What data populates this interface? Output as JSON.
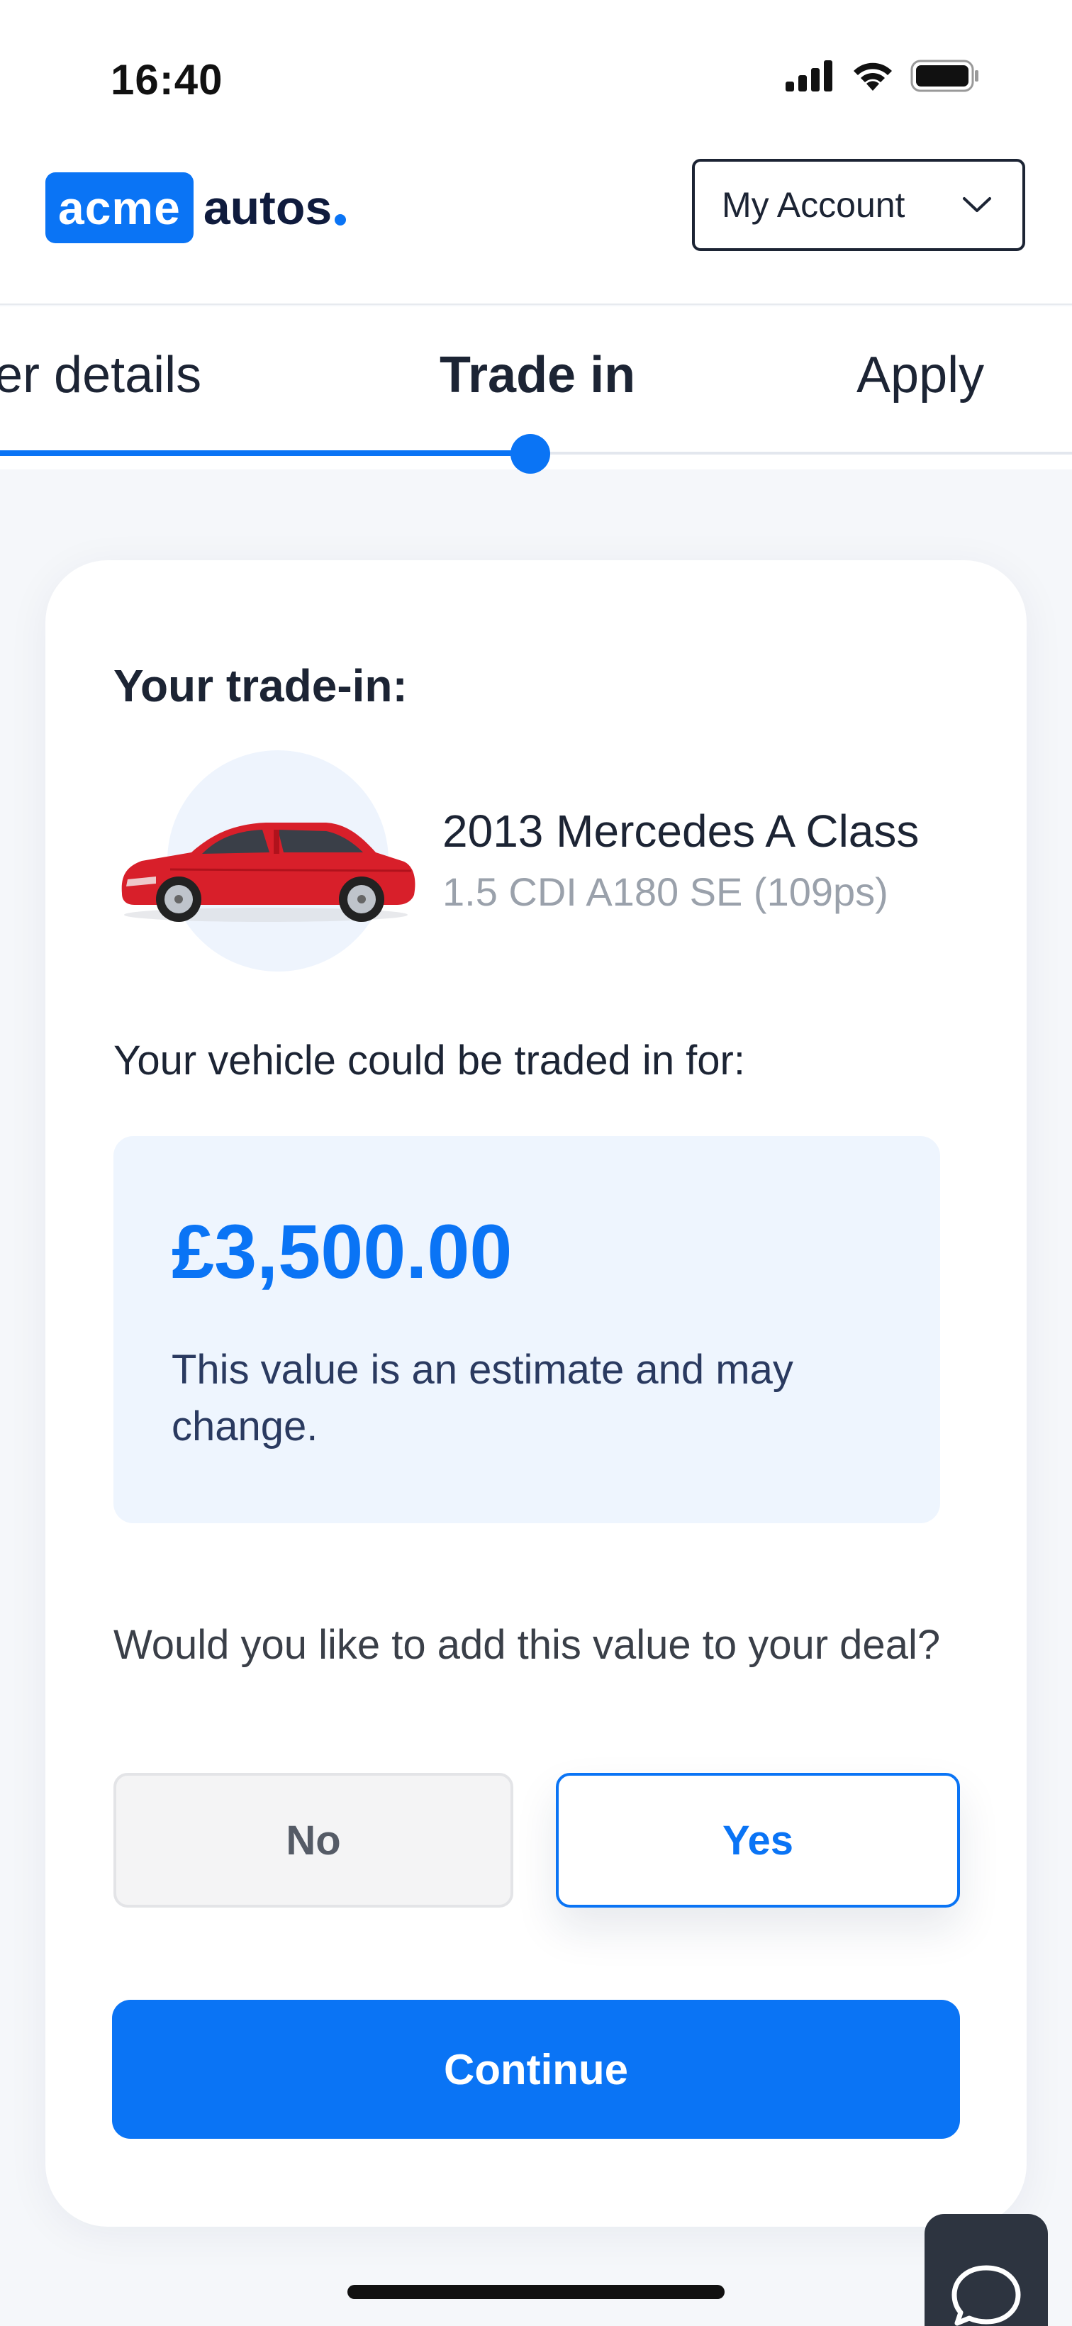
{
  "status_bar": {
    "time": "16:40",
    "icons": [
      "signal-icon",
      "wifi-icon",
      "battery-icon"
    ]
  },
  "header": {
    "logo_box_text": "acme",
    "logo_word": "autos",
    "account_label": "My Account",
    "account_icon": "chevron-down-icon"
  },
  "stepper": {
    "prev": "er details",
    "current": "Trade in",
    "next": "Apply"
  },
  "trade_in": {
    "title": "Your trade-in:",
    "vehicle_name": "2013 Mercedes A Class",
    "vehicle_spec": "1.5 CDI A180 SE (109ps)",
    "traded_label": "Your vehicle could be traded in for:",
    "value": "£3,500.00",
    "value_note": "This value is an estimate and may change.",
    "question": "Would you like to add this value to your deal?",
    "no_label": "No",
    "yes_label": "Yes",
    "selected": "Yes",
    "continue_label": "Continue"
  },
  "colors": {
    "accent": "#0a74f5",
    "navy": "#0f1b3d",
    "car_red": "#d81f2a"
  }
}
